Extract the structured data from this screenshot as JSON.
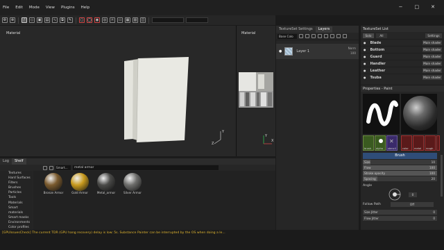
{
  "menu": [
    "File",
    "Edit",
    "Mode",
    "View",
    "Plugins",
    "Help"
  ],
  "window_controls": [
    "−",
    "□",
    "✕"
  ],
  "viewport": {
    "label_3d": "Material",
    "label_2d": "Material",
    "axis_y": "Y",
    "axis_z": "Z",
    "axis_x": "X"
  },
  "layers_panel": {
    "tabs": [
      "TextureSet Settings",
      "Layers"
    ],
    "channel_select": "Base Colo",
    "layer_name": "Layer 1",
    "blend_mode": "Norm",
    "opacity": "100"
  },
  "textureset_list": {
    "title": "TextureSet List",
    "solo_label": "Solo",
    "all_label": "All",
    "settings_label": "Settings",
    "items": [
      {
        "name": "Blade",
        "shader": "Main shader"
      },
      {
        "name": "Bottom",
        "shader": "Main shader"
      },
      {
        "name": "Guard",
        "shader": "Main shader"
      },
      {
        "name": "Handler",
        "shader": "Main shader"
      },
      {
        "name": "Leather",
        "shader": "Main shader"
      },
      {
        "name": "Tsuba",
        "shader": "Main shader"
      }
    ]
  },
  "properties": {
    "title": "Properties - Paint",
    "thumb_labels": [
      "brush",
      "alpha",
      "stencil",
      "color",
      "metal",
      "rough"
    ],
    "section": "Brush",
    "sliders": [
      {
        "label": "Size",
        "value": "10",
        "fill": 0.1
      },
      {
        "label": "Flow",
        "value": "100",
        "fill": 1.0
      },
      {
        "label": "Stroke opacity",
        "value": "100",
        "fill": 1.0
      },
      {
        "label": "Spacing",
        "value": "20",
        "fill": 0.2
      }
    ],
    "angle_label": "Angle",
    "angle_value": "0",
    "follow_path_label": "Follow Path",
    "follow_path_value": "Off",
    "size_jitter_label": "Size Jitter",
    "flow_jitter_label": "Flow Jitter",
    "jitter_value": "0"
  },
  "shelf": {
    "tabs": [
      "Log",
      "Shelf"
    ],
    "filter": "Smart...",
    "search": "metal armor",
    "categories": [
      "Textures",
      "Hard Surfaces",
      "Filters",
      "Brushes",
      "Particles",
      "Tools",
      "Materials",
      "Smart materials",
      "Smart masks",
      "Environments",
      "Color profiles"
    ],
    "materials": [
      {
        "name": "Bronze Armor",
        "color": "#7a5a2e"
      },
      {
        "name": "Gold Armor",
        "color": "#c89a1e"
      },
      {
        "name": "Metal_armor",
        "color": "#4a4a48"
      },
      {
        "name": "Silver Armor",
        "color": "#6e6e6c"
      }
    ]
  },
  "status": "[GPUIssuesCheck] The current TDR (GPU hang recovery) delay is low: 5s. Substance Painter can be interrupted by the OS when doing a le..."
}
